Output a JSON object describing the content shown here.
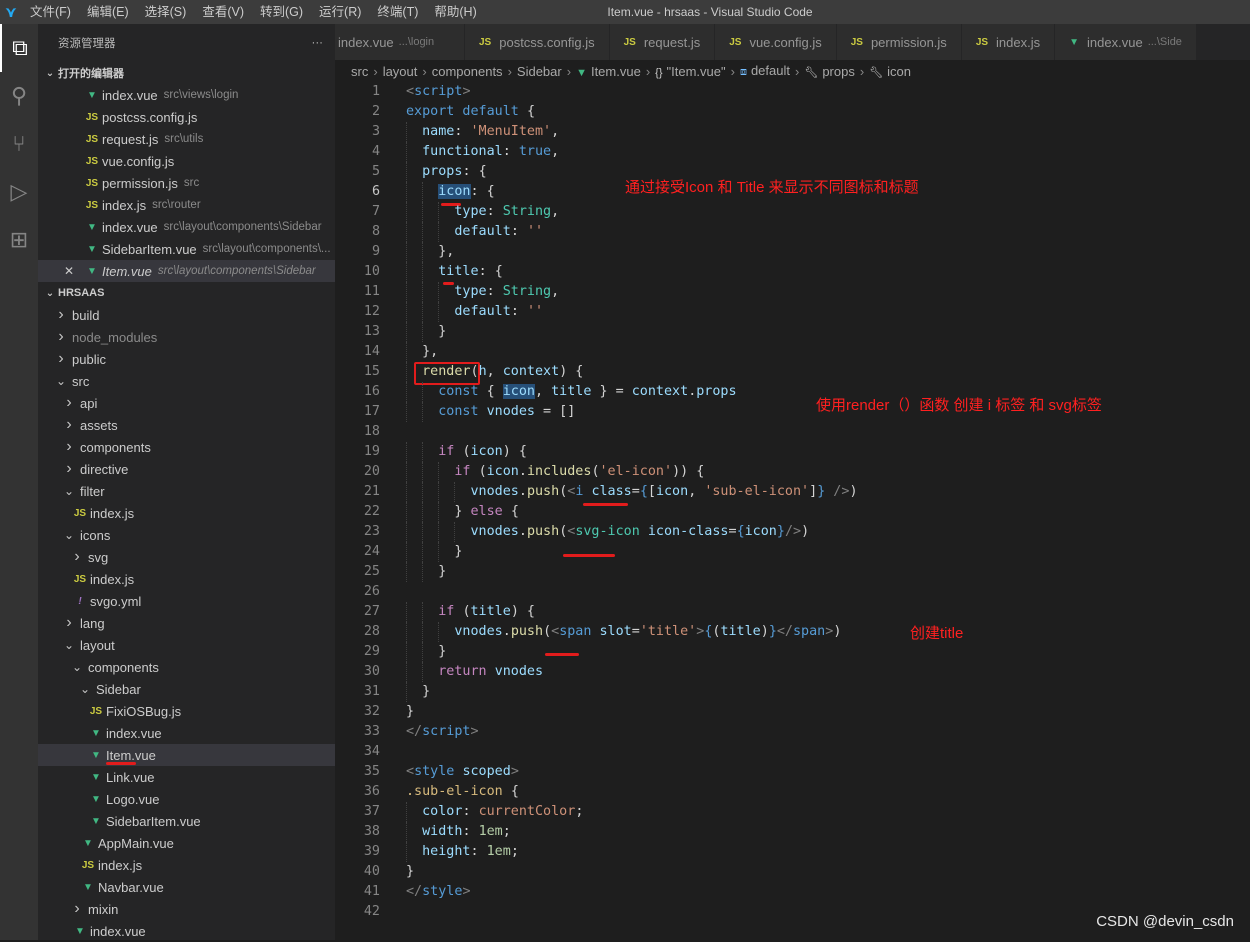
{
  "app": {
    "window_title": "Item.vue - hrsaas - Visual Studio Code",
    "menu": [
      "文件(F)",
      "编辑(E)",
      "选择(S)",
      "查看(V)",
      "转到(G)",
      "运行(R)",
      "终端(T)",
      "帮助(H)"
    ]
  },
  "activity_bar": {
    "icons": [
      "files-icon",
      "search-icon",
      "source-control-icon",
      "run-debug-icon",
      "extensions-icon"
    ]
  },
  "sidebar": {
    "title": "资源管理器",
    "more": "···",
    "open_editors_title": "打开的编辑器",
    "open_editors": [
      {
        "name": "index.vue",
        "desc": "src\\views\\login",
        "type": "vue"
      },
      {
        "name": "postcss.config.js",
        "desc": "",
        "type": "js"
      },
      {
        "name": "request.js",
        "desc": "src\\utils",
        "type": "js"
      },
      {
        "name": "vue.config.js",
        "desc": "",
        "type": "js"
      },
      {
        "name": "permission.js",
        "desc": "src",
        "type": "js"
      },
      {
        "name": "index.js",
        "desc": "src\\router",
        "type": "js"
      },
      {
        "name": "index.vue",
        "desc": "src\\layout\\components\\Sidebar",
        "type": "vue"
      },
      {
        "name": "SidebarItem.vue",
        "desc": "src\\layout\\components\\...",
        "type": "vue"
      },
      {
        "name": "Item.vue",
        "desc": "src\\layout\\components\\Sidebar",
        "type": "vue",
        "active": true
      }
    ],
    "project_title": "HRSAAS",
    "tree": [
      {
        "name": "build",
        "depth": 0,
        "type": "folder",
        "open": false
      },
      {
        "name": "node_modules",
        "depth": 0,
        "type": "folder",
        "open": false,
        "dim": true
      },
      {
        "name": "public",
        "depth": 0,
        "type": "folder",
        "open": false
      },
      {
        "name": "src",
        "depth": 0,
        "type": "folder",
        "open": true
      },
      {
        "name": "api",
        "depth": 1,
        "type": "folder",
        "open": false
      },
      {
        "name": "assets",
        "depth": 1,
        "type": "folder",
        "open": false
      },
      {
        "name": "components",
        "depth": 1,
        "type": "folder",
        "open": false
      },
      {
        "name": "directive",
        "depth": 1,
        "type": "folder",
        "open": false
      },
      {
        "name": "filter",
        "depth": 1,
        "type": "folder",
        "open": true
      },
      {
        "name": "index.js",
        "depth": 2,
        "type": "js"
      },
      {
        "name": "icons",
        "depth": 1,
        "type": "folder",
        "open": true
      },
      {
        "name": "svg",
        "depth": 2,
        "type": "folder",
        "open": false
      },
      {
        "name": "index.js",
        "depth": 2,
        "type": "js"
      },
      {
        "name": "svgo.yml",
        "depth": 2,
        "type": "yml"
      },
      {
        "name": "lang",
        "depth": 1,
        "type": "folder",
        "open": false
      },
      {
        "name": "layout",
        "depth": 1,
        "type": "folder",
        "open": true
      },
      {
        "name": "components",
        "depth": 2,
        "type": "folder",
        "open": true
      },
      {
        "name": "Sidebar",
        "depth": 3,
        "type": "folder",
        "open": true
      },
      {
        "name": "FixiOSBug.js",
        "depth": 4,
        "type": "js"
      },
      {
        "name": "index.vue",
        "depth": 4,
        "type": "vue"
      },
      {
        "name": "Item.vue",
        "depth": 4,
        "type": "vue",
        "selected": true
      },
      {
        "name": "Link.vue",
        "depth": 4,
        "type": "vue"
      },
      {
        "name": "Logo.vue",
        "depth": 4,
        "type": "vue"
      },
      {
        "name": "SidebarItem.vue",
        "depth": 4,
        "type": "vue"
      },
      {
        "name": "AppMain.vue",
        "depth": 3,
        "type": "vue"
      },
      {
        "name": "index.js",
        "depth": 3,
        "type": "js"
      },
      {
        "name": "Navbar.vue",
        "depth": 3,
        "type": "vue"
      },
      {
        "name": "mixin",
        "depth": 2,
        "type": "folder",
        "open": false
      },
      {
        "name": "index.vue",
        "depth": 2,
        "type": "vue"
      }
    ]
  },
  "tabs": [
    {
      "name": "index.vue",
      "desc": "...\\login",
      "type": "vue"
    },
    {
      "name": "postcss.config.js",
      "desc": "",
      "type": "js"
    },
    {
      "name": "request.js",
      "desc": "",
      "type": "js"
    },
    {
      "name": "vue.config.js",
      "desc": "",
      "type": "js"
    },
    {
      "name": "permission.js",
      "desc": "",
      "type": "js"
    },
    {
      "name": "index.js",
      "desc": "",
      "type": "js"
    },
    {
      "name": "index.vue",
      "desc": "...\\Side",
      "type": "vue"
    }
  ],
  "breadcrumb": [
    {
      "text": "src"
    },
    {
      "text": "layout"
    },
    {
      "text": "components"
    },
    {
      "text": "Sidebar"
    },
    {
      "text": "Item.vue",
      "icon": "vue-icon"
    },
    {
      "text": "\"Item.vue\"",
      "icon": "braces-icon"
    },
    {
      "text": "default",
      "icon": "module-icon"
    },
    {
      "text": "props",
      "icon": "wrench-icon"
    },
    {
      "text": "icon",
      "icon": "wrench-icon"
    }
  ],
  "editor": {
    "current_line": 6,
    "lines": [
      [
        [
          "<",
          "tag"
        ],
        [
          "script",
          "tn"
        ],
        [
          ">",
          "tag"
        ]
      ],
      [
        [
          "export default ",
          "kw"
        ],
        [
          "{",
          "p"
        ]
      ],
      [
        [
          "  "
        ],
        [
          "name",
          "key"
        ],
        [
          ": ",
          "p"
        ],
        [
          "'MenuItem'",
          "str"
        ],
        [
          ",",
          "p"
        ]
      ],
      [
        [
          "  "
        ],
        [
          "functional",
          "key"
        ],
        [
          ": ",
          "p"
        ],
        [
          "true",
          "kw"
        ],
        [
          ",",
          "p"
        ]
      ],
      [
        [
          "  "
        ],
        [
          "props",
          "key"
        ],
        [
          ": ",
          "p"
        ],
        [
          "{",
          "p"
        ]
      ],
      [
        [
          "    "
        ],
        [
          "icon",
          "key hl"
        ],
        [
          ": ",
          "p"
        ],
        [
          "{",
          "p"
        ]
      ],
      [
        [
          "      "
        ],
        [
          "type",
          "key"
        ],
        [
          ": ",
          "p"
        ],
        [
          "String",
          "type"
        ],
        [
          ",",
          "p"
        ]
      ],
      [
        [
          "      "
        ],
        [
          "default",
          "key"
        ],
        [
          ": ",
          "p"
        ],
        [
          "''",
          "str"
        ]
      ],
      [
        [
          "    "
        ],
        [
          "},",
          "p"
        ]
      ],
      [
        [
          "    "
        ],
        [
          "title",
          "key"
        ],
        [
          ": ",
          "p"
        ],
        [
          "{",
          "p"
        ]
      ],
      [
        [
          "      "
        ],
        [
          "type",
          "key"
        ],
        [
          ": ",
          "p"
        ],
        [
          "String",
          "type"
        ],
        [
          ",",
          "p"
        ]
      ],
      [
        [
          "      "
        ],
        [
          "default",
          "key"
        ],
        [
          ": ",
          "p"
        ],
        [
          "''",
          "str"
        ]
      ],
      [
        [
          "    "
        ],
        [
          "}",
          "p"
        ]
      ],
      [
        [
          "  "
        ],
        [
          "},",
          "p"
        ]
      ],
      [
        [
          "  "
        ],
        [
          "render",
          "fn"
        ],
        [
          "(",
          "p"
        ],
        [
          "h",
          "var"
        ],
        [
          ", ",
          "p"
        ],
        [
          "context",
          "var"
        ],
        [
          ") {",
          "p"
        ]
      ],
      [
        [
          "    "
        ],
        [
          "const ",
          "kw"
        ],
        [
          "{ ",
          "p"
        ],
        [
          "icon",
          "var hl"
        ],
        [
          ", ",
          "p"
        ],
        [
          "title",
          "var"
        ],
        [
          " } = ",
          "p"
        ],
        [
          "context",
          "var"
        ],
        [
          ".",
          "p"
        ],
        [
          "props",
          "var"
        ]
      ],
      [
        [
          "    "
        ],
        [
          "const ",
          "kw"
        ],
        [
          "vnodes",
          "var"
        ],
        [
          " = []",
          "p"
        ]
      ],
      [
        [
          ""
        ]
      ],
      [
        [
          "    "
        ],
        [
          "if ",
          "ctl"
        ],
        [
          "(",
          "p"
        ],
        [
          "icon",
          "var"
        ],
        [
          ") {",
          "p"
        ]
      ],
      [
        [
          "      "
        ],
        [
          "if ",
          "ctl"
        ],
        [
          "(",
          "p"
        ],
        [
          "icon",
          "var"
        ],
        [
          ".",
          "p"
        ],
        [
          "includes",
          "fn"
        ],
        [
          "(",
          "p"
        ],
        [
          "'el-icon'",
          "str"
        ],
        [
          ")) {",
          "p"
        ]
      ],
      [
        [
          "        "
        ],
        [
          "vnodes",
          "var"
        ],
        [
          ".",
          "p"
        ],
        [
          "push",
          "fn"
        ],
        [
          "(",
          "p"
        ],
        [
          "<",
          "tag"
        ],
        [
          "i ",
          "tn"
        ],
        [
          "class",
          "attr"
        ],
        [
          "=",
          "p"
        ],
        [
          "{",
          "tn"
        ],
        [
          "[",
          "p"
        ],
        [
          "icon",
          "var"
        ],
        [
          ", ",
          "p"
        ],
        [
          "'sub-el-icon'",
          "str"
        ],
        [
          "]",
          "p"
        ],
        [
          "}",
          "tn"
        ],
        [
          " />",
          "tag"
        ],
        [
          ")",
          "p"
        ]
      ],
      [
        [
          "      "
        ],
        [
          "} ",
          "p"
        ],
        [
          "else ",
          "ctl"
        ],
        [
          "{",
          "p"
        ]
      ],
      [
        [
          "        "
        ],
        [
          "vnodes",
          "var"
        ],
        [
          ".",
          "p"
        ],
        [
          "push",
          "fn"
        ],
        [
          "(",
          "p"
        ],
        [
          "<",
          "tag"
        ],
        [
          "svg-icon ",
          "type"
        ],
        [
          "icon-class",
          "attr"
        ],
        [
          "=",
          "p"
        ],
        [
          "{",
          "tn"
        ],
        [
          "icon",
          "var"
        ],
        [
          "}",
          "tn"
        ],
        [
          "/>",
          "tag"
        ],
        [
          ")",
          "p"
        ]
      ],
      [
        [
          "      "
        ],
        [
          "}",
          "p"
        ]
      ],
      [
        [
          "    "
        ],
        [
          "}",
          "p"
        ]
      ],
      [
        [
          ""
        ]
      ],
      [
        [
          "    "
        ],
        [
          "if ",
          "ctl"
        ],
        [
          "(",
          "p"
        ],
        [
          "title",
          "var"
        ],
        [
          ") {",
          "p"
        ]
      ],
      [
        [
          "      "
        ],
        [
          "vnodes",
          "var"
        ],
        [
          ".",
          "p"
        ],
        [
          "push",
          "fn"
        ],
        [
          "(",
          "p"
        ],
        [
          "<",
          "tag"
        ],
        [
          "span ",
          "tn"
        ],
        [
          "slot",
          "attr"
        ],
        [
          "=",
          "p"
        ],
        [
          "'title'",
          "str"
        ],
        [
          ">",
          "tag"
        ],
        [
          "{",
          "tn"
        ],
        [
          "(",
          "p"
        ],
        [
          "title",
          "var"
        ],
        [
          ")",
          "p"
        ],
        [
          "}",
          "tn"
        ],
        [
          "</",
          "tag"
        ],
        [
          "span",
          "tn"
        ],
        [
          ">",
          "tag"
        ],
        [
          ")",
          "p"
        ]
      ],
      [
        [
          "    "
        ],
        [
          "}",
          "p"
        ]
      ],
      [
        [
          "    "
        ],
        [
          "return ",
          "ctl"
        ],
        [
          "vnodes",
          "var"
        ]
      ],
      [
        [
          "  "
        ],
        [
          "}",
          "p"
        ]
      ],
      [
        [
          "}",
          "p"
        ]
      ],
      [
        [
          "</",
          "tag"
        ],
        [
          "script",
          "tn"
        ],
        [
          ">",
          "tag"
        ]
      ],
      [
        [
          ""
        ]
      ],
      [
        [
          "<",
          "tag"
        ],
        [
          "style ",
          "tn"
        ],
        [
          "scoped",
          "attr"
        ],
        [
          ">",
          "tag"
        ]
      ],
      [
        [
          ".sub-el-icon ",
          "sel"
        ],
        [
          "{",
          "p"
        ]
      ],
      [
        [
          "  "
        ],
        [
          "color",
          "key"
        ],
        [
          ": ",
          "p"
        ],
        [
          "currentColor",
          "str"
        ],
        [
          ";",
          "p"
        ]
      ],
      [
        [
          "  "
        ],
        [
          "width",
          "key"
        ],
        [
          ": ",
          "p"
        ],
        [
          "1em",
          "num"
        ],
        [
          ";",
          "p"
        ]
      ],
      [
        [
          "  "
        ],
        [
          "height",
          "key"
        ],
        [
          ": ",
          "p"
        ],
        [
          "1em",
          "num"
        ],
        [
          ";",
          "p"
        ]
      ],
      [
        [
          "}",
          "p"
        ]
      ],
      [
        [
          "</",
          "tag"
        ],
        [
          "style",
          "tn"
        ],
        [
          ">",
          "tag"
        ]
      ],
      [
        [
          ""
        ]
      ]
    ]
  },
  "annotations": {
    "a1": "通过接受Icon 和 Title 来显示不同图标和标题",
    "a2": "使用render（）函数 创建 i 标签 和 svg标签",
    "a3": "创建title"
  },
  "watermark": "CSDN @devin_csdn",
  "colors": {
    "activity_bar": "#333333",
    "sidebar": "#252526",
    "editor": "#1e1e1e",
    "annotation": "#ff2020",
    "vue": "#41b883",
    "js": "#cbcb41"
  }
}
